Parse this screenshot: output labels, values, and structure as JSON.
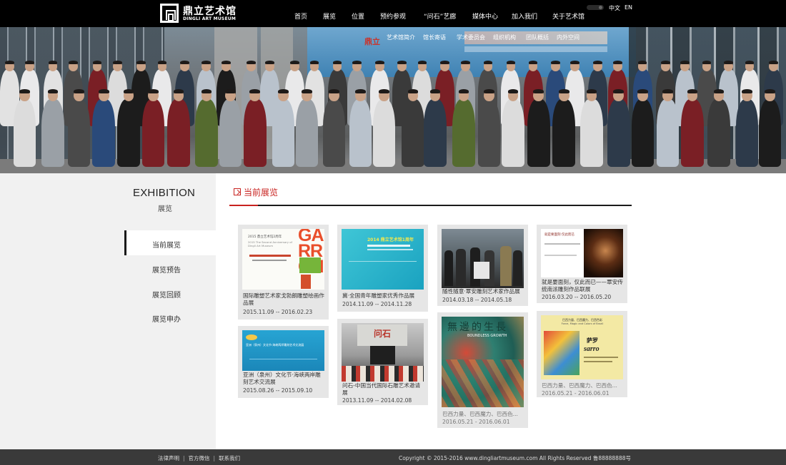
{
  "brand": {
    "name_cn": "鼎立艺术馆",
    "name_en": "DINGLI ART MUSEUM"
  },
  "nav": {
    "items": [
      "首页",
      "展览",
      "位置",
      "预约参观",
      "“问石”艺廊",
      "媒体中心",
      "加入我们",
      "关于艺术馆"
    ],
    "active_index": 7
  },
  "lang": {
    "cn": "中文",
    "en": "EN"
  },
  "subnav": {
    "items": [
      "艺术馆简介",
      "馆长寄语",
      "学术委员会",
      "组织机构",
      "团队概括",
      "内外空间"
    ]
  },
  "banner": {
    "sign_text": "鼎立"
  },
  "sidebar": {
    "title_en": "EXHIBITION",
    "title_cn": "展览",
    "items": [
      "当前展览",
      "展览预告",
      "展览回顾",
      "展览申办"
    ],
    "active_index": 0
  },
  "section": {
    "title": "当前展览"
  },
  "cards": [
    {
      "title": "国际雕塑艺术家戈勃朗雕塑绘画作品展",
      "date": "2015.11.09 -- 2016.02.23",
      "grey": false
    },
    {
      "title": "冀·全国青年雕塑家优秀作品展",
      "date": "2014.11.09 -- 2014.11.28",
      "grey": false
    },
    {
      "title": "随性随意·覃安雕刻艺术家作品展",
      "date": "2014.03.18 -- 2014.05.18",
      "grey": false
    },
    {
      "title": "就是要面刻，仅此而已——覃安传统南派雕刻作品联展",
      "date": "2016.03.20 -- 2016.05.20",
      "grey": false
    },
    {
      "title": "亚洲（泉州）文化节·海峡两岸雕刻艺术交流展",
      "date": "2015.08.26 -- 2015.09.10",
      "grey": false
    },
    {
      "title": "问石-中国当代国际石雕艺术邀请展",
      "date": "2013.11.09 -- 2014.02.08",
      "grey": false
    },
    {
      "title": "巴西力量、巴西魔力、巴西色...",
      "date": "2016.05.21 - 2016.06.01",
      "grey": true
    },
    {
      "title": "巴西力量、巴西魔力、巴西色...",
      "date": "2016.05.21 - 2016.06.01",
      "grey": true
    }
  ],
  "thumb_text": {
    "c1_head": "2015 鼎立艺术馆2周年",
    "c1_sub": "2015 The Second Anniversary of Dingli Art Museum",
    "c1_big": "GARRON",
    "c2_big": "2014 鼎立艺术馆1周年",
    "c4_head": "就是要面刻 仅此而已",
    "c5_line": "亚洲（泉州）文化节·海峡两岸雕刻艺术交流展",
    "c6_sign": "问石",
    "c7_title": "無邊的生長",
    "c7_sub": "BOUNDLESS GROWTH",
    "c8_head": "巴西力量、巴西魔力、巴西色彩",
    "c8_sub": "Force, Magic and Colors of Brazil",
    "c8_name": "萨罗",
    "c8_logo": "sarro"
  },
  "footer": {
    "links": [
      "法律声明",
      "官方微信",
      "联系我们"
    ],
    "copyright": "Copyright © 2015-2016 www.dingliartmuseum.com All Rights Reserved 鲁88888888号"
  },
  "colors": {
    "accent": "#c8221f",
    "topbar": "#000000",
    "footer": "#3a3a3a"
  }
}
